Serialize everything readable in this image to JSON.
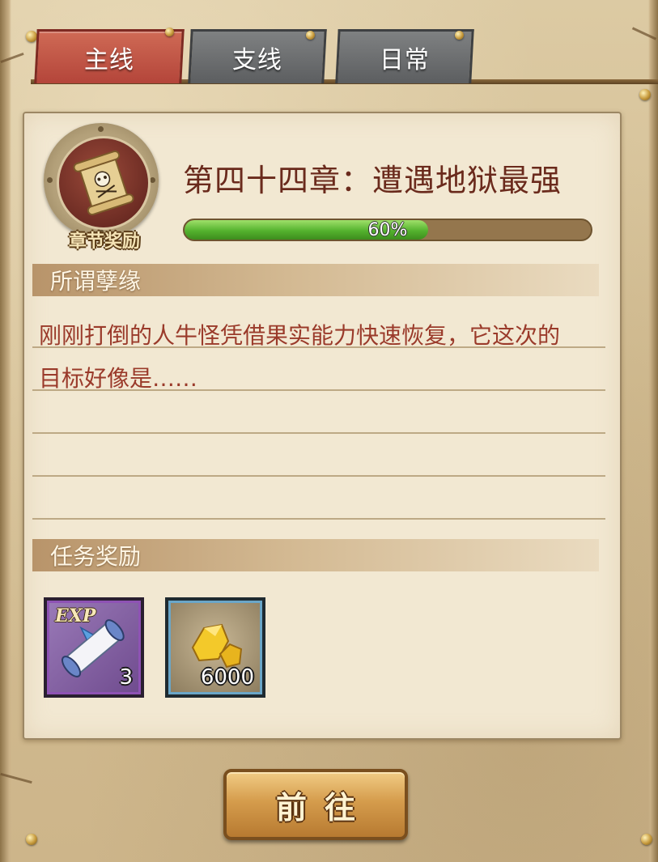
{
  "tabs": {
    "main": "主线",
    "side": "支线",
    "daily": "日常",
    "active": "main"
  },
  "chapter": {
    "reward_badge_label": "章节奖励",
    "title": "第四十四章：遭遇地狱最强",
    "progress_percent": 60,
    "progress_text": "60%"
  },
  "quest": {
    "section_title": "所谓孽缘",
    "description_line1": "刚刚打倒的人牛怪凭借果实能力快速恢复，它这次的",
    "description_line2": "目标好像是……"
  },
  "rewards": {
    "section_title": "任务奖励",
    "items": [
      {
        "icon": "exp-scroll-icon",
        "label": "EXP",
        "quantity": "3",
        "frame_color": "#8e52b4"
      },
      {
        "icon": "gold-ore-icon",
        "quantity": "6000",
        "frame_color": "#6aa6c8"
      }
    ]
  },
  "action": {
    "go_label": "前往"
  },
  "colors": {
    "tab_active": "#c0503f",
    "tab_inactive": "#6d6f71",
    "title_text": "#6a2a1c",
    "description_text": "#9a3a2a",
    "progress_fill": "#54b22e"
  }
}
